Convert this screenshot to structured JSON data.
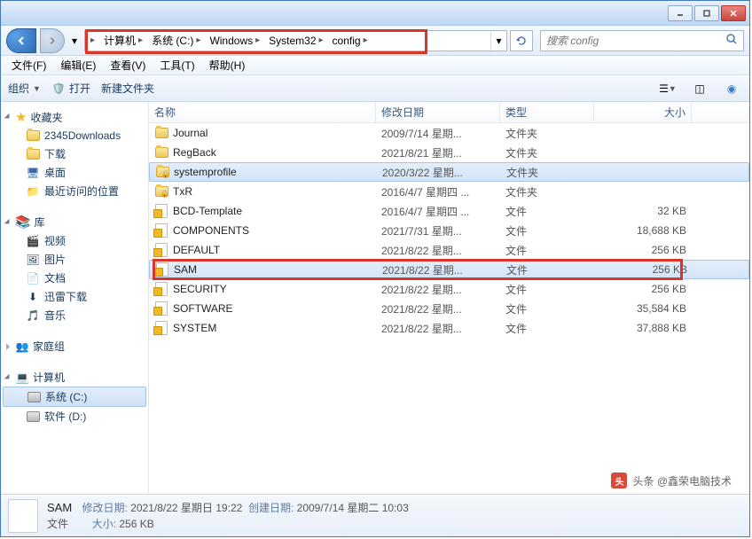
{
  "breadcrumbs": [
    {
      "label": "计算机"
    },
    {
      "label": "系统 (C:)"
    },
    {
      "label": "Windows"
    },
    {
      "label": "System32"
    },
    {
      "label": "config"
    }
  ],
  "search": {
    "placeholder": "搜索 config"
  },
  "menus": {
    "file": "文件(F)",
    "edit": "编辑(E)",
    "view": "查看(V)",
    "tools": "工具(T)",
    "help": "帮助(H)"
  },
  "toolbar": {
    "organize": "组织",
    "open": "打开",
    "newfolder": "新建文件夹"
  },
  "sidebar": {
    "favorites": {
      "label": "收藏夹",
      "items": [
        {
          "label": "2345Downloads",
          "icon": "folder"
        },
        {
          "label": "下载",
          "icon": "folder"
        },
        {
          "label": "桌面",
          "icon": "desktop"
        },
        {
          "label": "最近访问的位置",
          "icon": "recent"
        }
      ]
    },
    "libraries": {
      "label": "库",
      "items": [
        {
          "label": "视频",
          "icon": "video"
        },
        {
          "label": "图片",
          "icon": "pictures"
        },
        {
          "label": "文档",
          "icon": "documents"
        },
        {
          "label": "迅雷下载",
          "icon": "download"
        },
        {
          "label": "音乐",
          "icon": "music"
        }
      ]
    },
    "homegroup": {
      "label": "家庭组"
    },
    "computer": {
      "label": "计算机",
      "items": [
        {
          "label": "系统 (C:)",
          "icon": "drive",
          "selected": true
        },
        {
          "label": "软件 (D:)",
          "icon": "drive"
        }
      ]
    }
  },
  "columns": {
    "name": "名称",
    "date": "修改日期",
    "type": "类型",
    "size": "大小"
  },
  "files": [
    {
      "name": "Journal",
      "date": "2009/7/14 星期...",
      "type": "文件夹",
      "size": "",
      "icon": "folder"
    },
    {
      "name": "RegBack",
      "date": "2021/8/21 星期...",
      "type": "文件夹",
      "size": "",
      "icon": "folder"
    },
    {
      "name": "systemprofile",
      "date": "2020/3/22 星期...",
      "type": "文件夹",
      "size": "",
      "icon": "folder-lock",
      "selected": true
    },
    {
      "name": "TxR",
      "date": "2016/4/7 星期四 ...",
      "type": "文件夹",
      "size": "",
      "icon": "folder-lock"
    },
    {
      "name": "BCD-Template",
      "date": "2016/4/7 星期四 ...",
      "type": "文件",
      "size": "32 KB",
      "icon": "file-lock"
    },
    {
      "name": "COMPONENTS",
      "date": "2021/7/31 星期...",
      "type": "文件",
      "size": "18,688 KB",
      "icon": "file-lock"
    },
    {
      "name": "DEFAULT",
      "date": "2021/8/22 星期...",
      "type": "文件",
      "size": "256 KB",
      "icon": "file-lock"
    },
    {
      "name": "SAM",
      "date": "2021/8/22 星期...",
      "type": "文件",
      "size": "256 KB",
      "icon": "file-lock",
      "highlighted": true
    },
    {
      "name": "SECURITY",
      "date": "2021/8/22 星期...",
      "type": "文件",
      "size": "256 KB",
      "icon": "file-lock"
    },
    {
      "name": "SOFTWARE",
      "date": "2021/8/22 星期...",
      "type": "文件",
      "size": "35,584 KB",
      "icon": "file-lock"
    },
    {
      "name": "SYSTEM",
      "date": "2021/8/22 星期...",
      "type": "文件",
      "size": "37,888 KB",
      "icon": "file-lock"
    }
  ],
  "status": {
    "filename": "SAM",
    "mod_label": "修改日期:",
    "mod_value": "2021/8/22 星期日 19:22",
    "create_label": "创建日期:",
    "create_value": "2009/7/14 星期二 10:03",
    "type_label": "文件",
    "size_label": "大小:",
    "size_value": "256 KB"
  },
  "watermark": {
    "prefix": "头条",
    "text": "@鑫荣电脑技术"
  }
}
